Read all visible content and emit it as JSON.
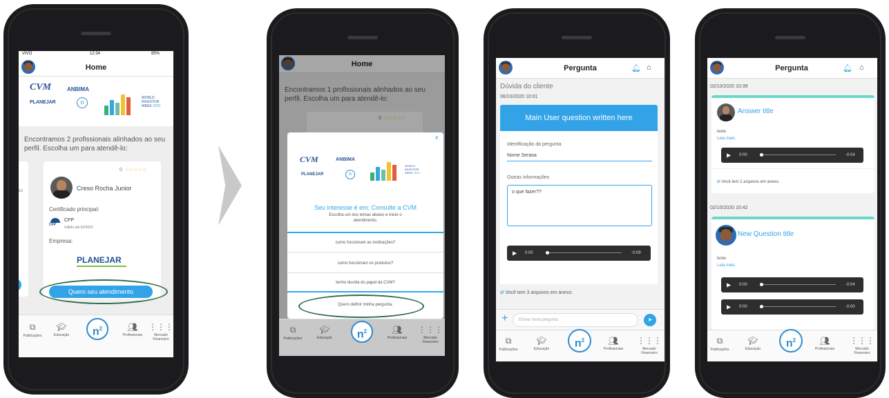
{
  "colors": {
    "accent": "#33a3e8",
    "highlight_ellipse": "#2e6b4a",
    "stars": "#f2c12e"
  },
  "phone1": {
    "status": {
      "carrier": "VIVO",
      "time": "12:34",
      "battery": "85%"
    },
    "nav_title": "Home",
    "banner": {
      "cvm": "CVM",
      "anbima": "ANBIMA",
      "planejar": "PLANEJAR",
      "n2": "n",
      "world": "WORLD",
      "investor": "INVESTOR",
      "week": "WEEK",
      "year": "2020"
    },
    "intro_text": "Encontramos 2 profissionais alinhados ao seu perfil. Escolha um para atendê-lo:",
    "card": {
      "rating": "0",
      "stars": "☆☆☆☆☆",
      "name": "Creso Rocha Junior",
      "cert_label": "Certificado principal:",
      "cert_name": "CFP",
      "cert_valid": "Válido até 02/2022",
      "company_label": "Empresa:",
      "company_logo": "PLANEJAR",
      "button": "Quero seu atendimento"
    },
    "side_card_text": "co",
    "tabs": [
      "Publicações",
      "Educação",
      "Profissionais",
      "Mercado Financeiro"
    ]
  },
  "phone2": {
    "nav_title": "Home",
    "intro_text": "Encontramos 1 profissionais alinhados ao seu perfil. Escolha um para atendê-lo:",
    "card_rating": "0",
    "card_stars": "☆☆☆☆☆",
    "modal": {
      "close": "x",
      "heading": "Seu interesse é em: Consulte a CVM",
      "subtext": "Escolha um dos temas abaixo e inicie o atendimento.",
      "options": [
        "como funcionam as instituições?",
        "como funcionam os produtos?",
        "tenho duvida do papel da CVM?",
        "Quero definir minha pergunta."
      ]
    },
    "tabs": [
      "Publicações",
      "Educação",
      "Profissionais",
      "Mercado Financeiro"
    ]
  },
  "phone3": {
    "nav_title": "Pergunta",
    "section": "Dúvida do cliente",
    "date": "06/10/2020 10:01",
    "question_title": "Main User question written here",
    "id_label": "Identificação da pergunta",
    "id_value": "Nome Serasa",
    "other_label": "Outras informações",
    "other_value": "o que fazer??",
    "audio": {
      "start": "0:00",
      "end": "-0:09"
    },
    "attachments": "Você tem 3 arquivos em anexo.",
    "input_placeholder": "Enviar nova pergunta",
    "tabs": [
      "Publicações",
      "Educação",
      "Profissionais",
      "Mercado Financeiro"
    ]
  },
  "phone4": {
    "nav_title": "Pergunta",
    "date1": "02/10/2020 10:39",
    "answer": {
      "title": "Answer title",
      "body": "teste",
      "more": "Leia mais.",
      "audio_start": "0:00",
      "audio_end": "-0:04",
      "attachments": "Você tem 2 arquivos em anexo."
    },
    "date2": "02/10/2020 10:42",
    "question": {
      "title": "New Question title",
      "body": "teste",
      "more": "Leia mais.",
      "audio1_start": "0:00",
      "audio1_end": "-0:04",
      "audio2_start": "0:00",
      "audio2_end": "-0:00"
    },
    "tabs": [
      "Publicações",
      "Educação",
      "Profissionais",
      "Mercado Financeiro"
    ]
  }
}
